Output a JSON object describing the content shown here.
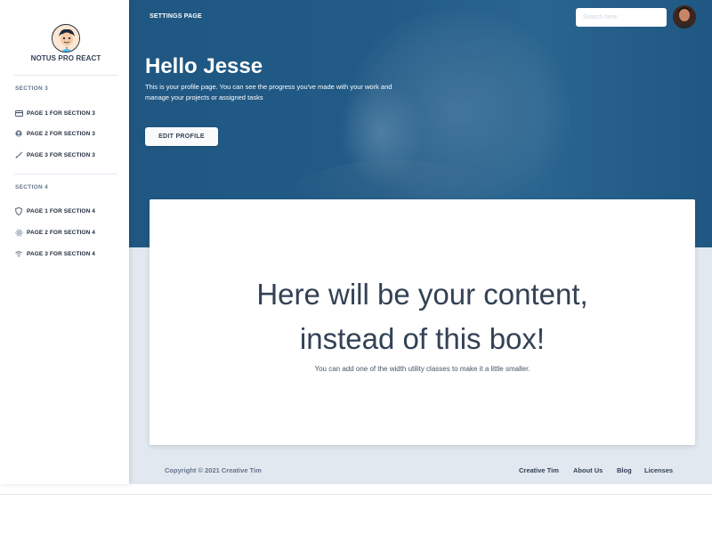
{
  "sidebar": {
    "brand": "NOTUS PRO REACT",
    "sections": [
      {
        "title": "SECTION 3",
        "items": [
          {
            "label": "PAGE 1 FOR SECTION 3",
            "icon": "card-icon"
          },
          {
            "label": "PAGE 2 FOR SECTION 3",
            "icon": "user-circle-icon"
          },
          {
            "label": "PAGE 3 FOR SECTION 3",
            "icon": "paint-brush-icon"
          }
        ]
      },
      {
        "title": "SECTION 4",
        "items": [
          {
            "label": "PAGE 1 FOR SECTION 4",
            "icon": "shield-icon"
          },
          {
            "label": "PAGE 2 FOR SECTION 4",
            "icon": "atom-icon"
          },
          {
            "label": "PAGE 3 FOR SECTION 4",
            "icon": "wifi-icon"
          }
        ]
      }
    ]
  },
  "navbar": {
    "page_link": "SETTINGS PAGE",
    "search_placeholder": "Search here"
  },
  "header": {
    "greeting": "Hello Jesse",
    "intro": "This is your profile page. You can see the progress you've made with your work and manage your projects or assigned tasks",
    "edit_button": "EDIT PROFILE"
  },
  "content": {
    "line1": "Here will be your content,",
    "line2": "instead of this box!",
    "subtitle": "You can add one of the width utility classes to make it a little smaller."
  },
  "footer": {
    "copyright": "Copyright © 2021 Creative Tim",
    "links": [
      "Creative Tim",
      "About Us",
      "Blog",
      "Licenses"
    ]
  },
  "colors": {
    "header_blue": "#235f8c",
    "page_gray": "#e2e8f0",
    "text_dark": "#334155"
  }
}
